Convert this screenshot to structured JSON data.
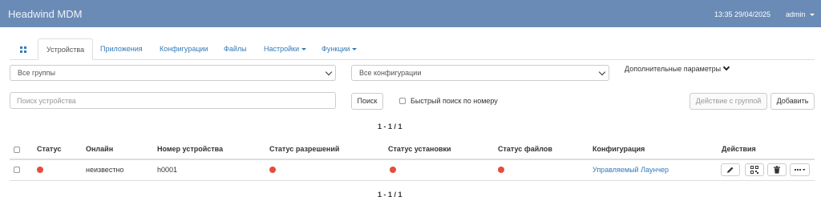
{
  "header": {
    "brand": "Headwind MDM",
    "datetime": "13:35 29/04/2025",
    "user": "admin"
  },
  "tabs": [
    {
      "label": "Устройства"
    },
    {
      "label": "Приложения"
    },
    {
      "label": "Конфигурации"
    },
    {
      "label": "Файлы"
    },
    {
      "label": "Настройки"
    },
    {
      "label": "Функции"
    }
  ],
  "filters": {
    "group": "Все группы",
    "configuration": "Все конфигурации",
    "advanced": "Дополнительные параметры",
    "search_placeholder": "Поиск устройства",
    "search_button": "Поиск",
    "quick_search": "Быстрый поиск по номеру",
    "group_action": "Действие с группой",
    "add": "Добавить"
  },
  "pagination": {
    "top": "1 - 1 / 1",
    "bottom": "1 - 1 / 1"
  },
  "table": {
    "headers": [
      "Статус",
      "Онлайн",
      "Номер устройства",
      "Статус разрешений",
      "Статус установки",
      "Статус файлов",
      "Конфигурация",
      "Действия"
    ],
    "rows": [
      {
        "online": "неизвестно",
        "number": "h0001",
        "configuration": "Управляемый Лаунчер",
        "status_color": "#e74c3c"
      }
    ]
  },
  "colors": {
    "header_bg": "#6a8bb5",
    "link": "#337ab7",
    "status_red": "#e74c3c"
  }
}
